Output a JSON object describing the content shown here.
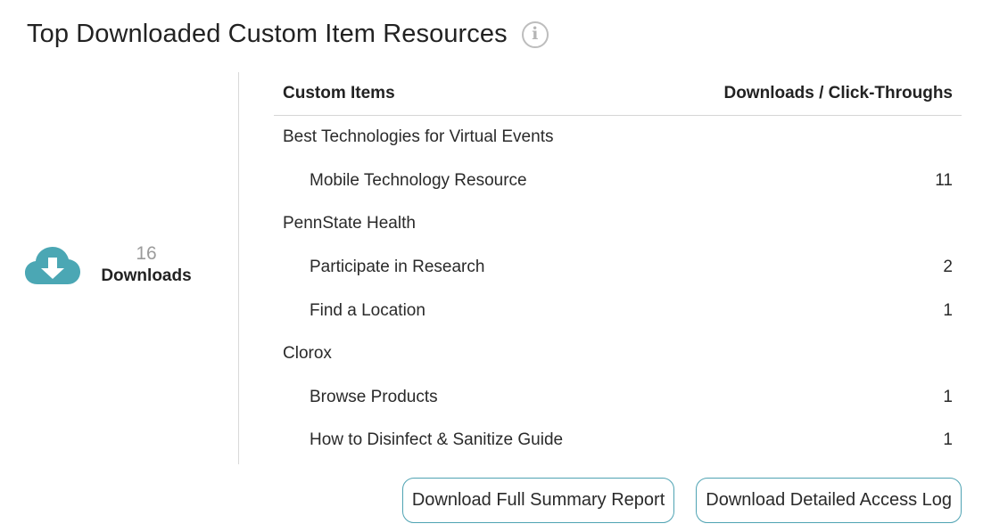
{
  "header": {
    "title": "Top Downloaded Custom Item Resources",
    "info_icon": "info-circle-icon"
  },
  "summary": {
    "icon": "cloud-download-icon",
    "icon_color": "#4ba7b4",
    "count": "16",
    "label": "Downloads"
  },
  "table": {
    "col_item": "Custom Items",
    "col_downloads": "Downloads / Click-Throughs",
    "rows": [
      {
        "label": "Best Technologies for Virtual Events",
        "value": "",
        "type": "group"
      },
      {
        "label": "Mobile Technology Resource",
        "value": "11",
        "type": "child"
      },
      {
        "label": "PennState Health",
        "value": "",
        "type": "group"
      },
      {
        "label": "Participate in Research",
        "value": "2",
        "type": "child"
      },
      {
        "label": "Find a Location",
        "value": "1",
        "type": "child"
      },
      {
        "label": "Clorox",
        "value": "",
        "type": "group"
      },
      {
        "label": "Browse Products",
        "value": "1",
        "type": "child"
      },
      {
        "label": "How to Disinfect & Sanitize Guide",
        "value": "1",
        "type": "child"
      }
    ]
  },
  "actions": {
    "summary_report": "Download Full Summary Report",
    "access_log": "Download Detailed Access Log",
    "button_border_color": "#4fa3b3"
  }
}
